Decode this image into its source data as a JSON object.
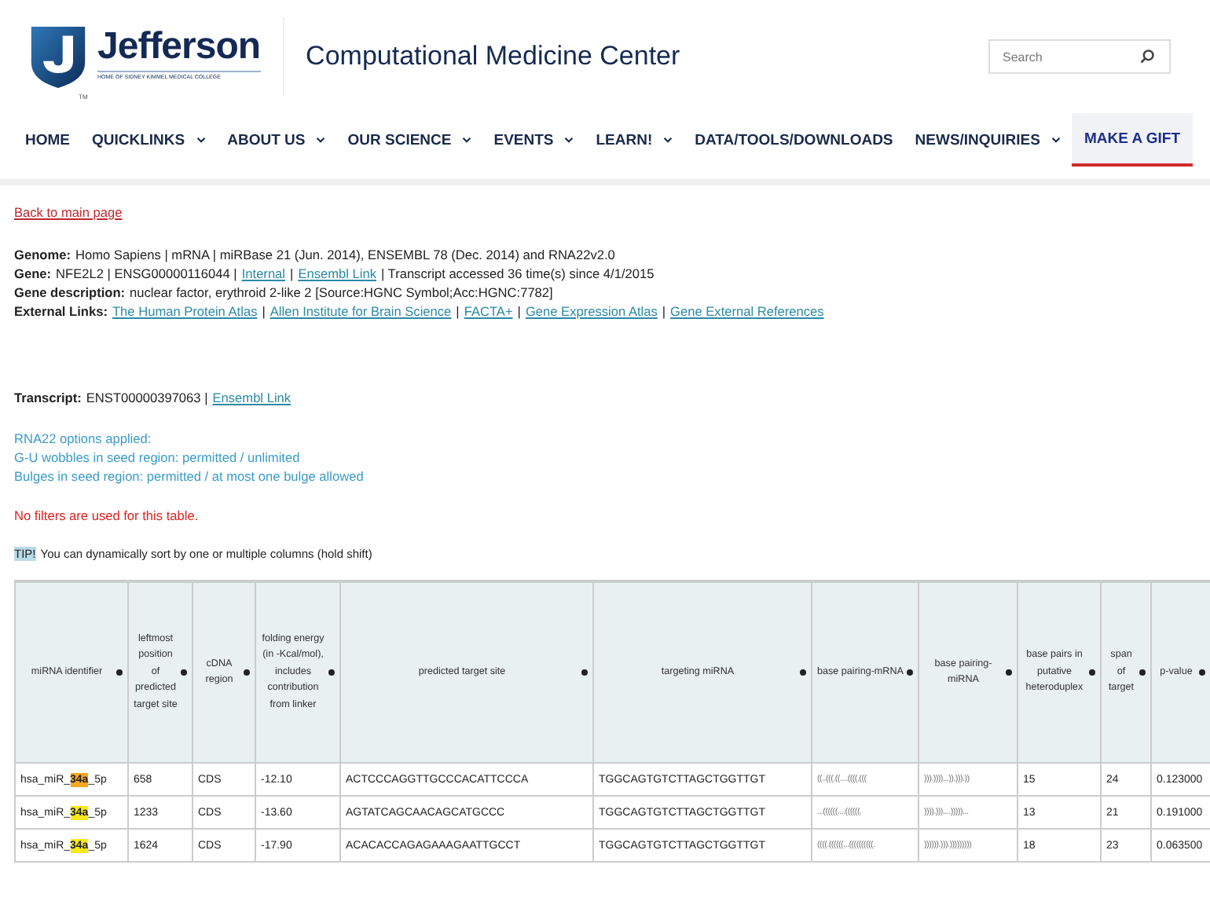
{
  "brand": {
    "name": "Jefferson",
    "tagline": "HOME OF SIDNEY KIMMEL MEDICAL COLLEGE",
    "tm": "TM"
  },
  "site_title": "Computational Medicine Center",
  "search": {
    "placeholder": "Search"
  },
  "nav": [
    {
      "label": "HOME",
      "dropdown": false,
      "selected": false
    },
    {
      "label": "QUICKLINKS",
      "dropdown": true,
      "selected": false
    },
    {
      "label": "ABOUT US",
      "dropdown": true,
      "selected": false
    },
    {
      "label": "OUR SCIENCE",
      "dropdown": true,
      "selected": false
    },
    {
      "label": "EVENTS",
      "dropdown": true,
      "selected": false
    },
    {
      "label": "LEARN!",
      "dropdown": true,
      "selected": false
    },
    {
      "label": "DATA/TOOLS/DOWNLOADS",
      "dropdown": false,
      "selected": false
    },
    {
      "label": "NEWS/INQUIRIES",
      "dropdown": true,
      "selected": false
    },
    {
      "label": "MAKE A GIFT",
      "dropdown": false,
      "selected": true
    }
  ],
  "back_link": "Back to main page",
  "info": [
    {
      "label": "Genome:",
      "parts": [
        {
          "text": "Homo Sapiens | mRNA | miRBase 21 (Jun. 2014), ENSEMBL 78 (Dec. 2014) and RNA22v2.0",
          "link": false
        }
      ]
    },
    {
      "label": "Gene:",
      "parts": [
        {
          "text": "NFE2L2 | ENSG00000116044 |",
          "link": false
        },
        {
          "text": "Internal",
          "link": true
        },
        {
          "text": "|",
          "link": false
        },
        {
          "text": "Ensembl Link",
          "link": true
        },
        {
          "text": "| Transcript accessed 36 time(s) since 4/1/2015",
          "link": false
        }
      ]
    },
    {
      "label": "Gene description:",
      "parts": [
        {
          "text": "nuclear factor, erythroid 2-like 2 [Source:HGNC Symbol;Acc:HGNC:7782]",
          "link": false
        }
      ]
    },
    {
      "label": "External Links:",
      "parts": [
        {
          "text": "The Human Protein Atlas",
          "link": true
        },
        {
          "text": "|",
          "link": false
        },
        {
          "text": "Allen Institute for Brain Science",
          "link": true
        },
        {
          "text": "|",
          "link": false
        },
        {
          "text": "FACTA+",
          "link": true
        },
        {
          "text": "|",
          "link": false
        },
        {
          "text": "Gene Expression Atlas",
          "link": true
        },
        {
          "text": "|",
          "link": false
        },
        {
          "text": "Gene External References",
          "link": true
        }
      ]
    }
  ],
  "transcript": {
    "label": "Transcript:",
    "parts": [
      {
        "text": "ENST00000397063 |",
        "link": false
      },
      {
        "text": "Ensembl Link",
        "link": true
      }
    ]
  },
  "options": [
    "RNA22 options applied:",
    "G-U wobbles in seed region: permitted / unlimited",
    "Bulges in seed region: permitted / at most one bulge allowed"
  ],
  "filter_note": "No filters are used for this table.",
  "tip": {
    "badge": "TIP!",
    "text": "You can dynamically sort by one or multiple columns (hold shift)"
  },
  "table": {
    "columns": [
      "miRNA identifier",
      "leftmost position of predicted target site",
      "cDNA region",
      "folding energy (in -Kcal/mol), includes contribution from linker",
      "predicted target site",
      "targeting miRNA",
      "base pairing-mRNA",
      "base pairing-miRNA",
      "base pairs in putative heteroduplex",
      "span of target",
      "p-value"
    ],
    "rows": [
      {
        "color": "#f5a623",
        "cells": [
          "hsa_miR_**34a**_5p",
          "658",
          "CDS",
          "-12.10",
          "ACTCCCAGGTTGCCCACATTCCCA",
          "TGGCAGTGTCTTAGCTGGTTGT",
          "((..(((.((....((((.(((",
          "))).))))...)).))).))",
          "15",
          "24",
          "0.123000"
        ]
      },
      {
        "color": "#f7e81c",
        "cells": [
          "hsa_miR_**34a**_5p",
          "1233",
          "CDS",
          "-13.60",
          "AGTATCAGCAACAGCATGCCC",
          "TGGCAGTGTCTTAGCTGGTTGT",
          "...((((((....((((((.",
          ")))).)))....)))))...",
          "13",
          "21",
          "0.191000"
        ]
      },
      {
        "color": "#f7e81c",
        "cells": [
          "hsa_miR_**34a**_5p",
          "1624",
          "CDS",
          "-17.90",
          "ACACACCAGAGAAAGAATTGCCT",
          "TGGCAGTGTCTTAGCTGGTTGT",
          "((((.((((((...((((((((((.",
          ")))))).))).)))))))))",
          "18",
          "23",
          "0.063500"
        ]
      }
    ]
  }
}
